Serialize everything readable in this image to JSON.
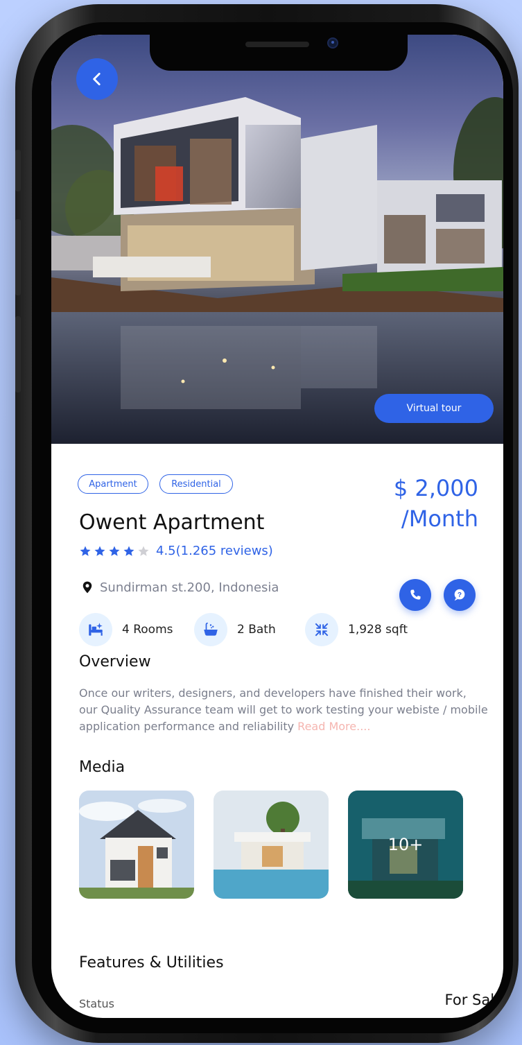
{
  "hero": {
    "virtual_tour_label": "Virtual tour",
    "back_icon": "chevron-left-icon"
  },
  "listing": {
    "tags": [
      "Apartment",
      "Residential"
    ],
    "price": "$ 2,000",
    "price_period": "/Month",
    "title": "Owent Apartment",
    "rating": {
      "filled_stars": 4,
      "total_stars": 5,
      "text": "4.5(1.265 reviews)"
    },
    "location": "Sundirman st.200, Indonesia",
    "actions": {
      "call_icon": "phone-icon",
      "chat_icon": "chat-question-icon"
    },
    "features": [
      {
        "icon": "bed-icon",
        "label": "4 Rooms"
      },
      {
        "icon": "bathtub-icon",
        "label": "2 Bath"
      },
      {
        "icon": "area-compress-icon",
        "label": "1,928 sqft"
      }
    ]
  },
  "overview": {
    "heading": "Overview",
    "text": "Once our writers, designers, and developers have finished their work, our Quality Assurance team will get to work testing your webiste / mobile application performance and reliability ",
    "read_more": "Read More...."
  },
  "media": {
    "heading": "Media",
    "more_count": "10+"
  },
  "features_utilities": {
    "heading": "Features & Utilities",
    "status_label": "Status",
    "status_value": "For Sale"
  },
  "colors": {
    "accent": "#2f63e6",
    "muted_text": "#7a7e8c",
    "read_more": "#f5b5b0",
    "feature_icon_bg": "#e6f2ff"
  }
}
